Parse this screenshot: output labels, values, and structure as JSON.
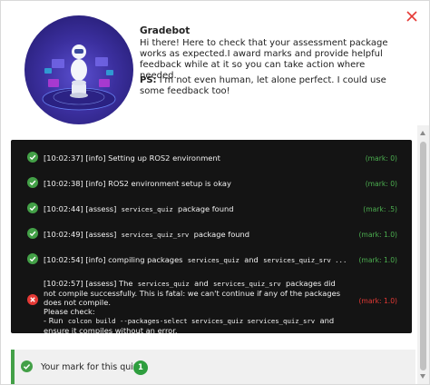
{
  "dialog": {
    "close_icon": "close-x-icon",
    "close_color": "#e53935"
  },
  "bot": {
    "name": "Gradebot",
    "intro": "Hi there! Here to check that your assessment package works as expected.I award marks and provide helpful feedback while at it so you can take action where needed.",
    "ps_label": "PS:",
    "ps_text": " I'm not even human, let alone perfect. I could use some feedback too!"
  },
  "log": {
    "entries": [
      {
        "status": "success",
        "icon": "check-circle-icon",
        "time": "[10:02:37]",
        "tag": "[info]",
        "text": "Setting up ROS2 environment",
        "mark": "(mark: 0)"
      },
      {
        "status": "success",
        "icon": "check-circle-icon",
        "time": "[10:02:38]",
        "tag": "[info]",
        "text": "ROS2 environment setup is okay",
        "mark": "(mark: 0)"
      },
      {
        "status": "success",
        "icon": "check-circle-icon",
        "time": "[10:02:44]",
        "tag": "[assess]",
        "code": "services_quiz",
        "text": "package found",
        "mark": "(mark: .5)"
      },
      {
        "status": "success",
        "icon": "check-circle-icon",
        "time": "[10:02:49]",
        "tag": "[assess]",
        "code": "services_quiz_srv",
        "text": "package found",
        "mark": "(mark: 1.0)"
      },
      {
        "status": "success",
        "icon": "check-circle-icon",
        "time": "[10:02:54]",
        "tag": "[info]",
        "text_pre": "compiling packages",
        "code1": "services_quiz",
        "text_mid": "and",
        "code2": "services_quiz_srv ...",
        "mark": "(mark: 1.0)"
      },
      {
        "status": "failure",
        "icon": "error-circle-icon",
        "time": "[10:02:57]",
        "tag": "[assess]",
        "text_pre": "The",
        "code1": "services_quiz",
        "text_mid": "and",
        "code2": "services_quiz_srv",
        "text_post": "packages did not compile successfully. This is fatal: we can't continue if any of the packages does not compile.",
        "line2": "Please check:",
        "line3_pre": "- Run",
        "line3_code": "colcon build --packages-select services_quiz services_quiz_srv",
        "line3_post": "and ensure it compiles without an error.",
        "mark": "(mark: 1.0)"
      }
    ],
    "success_color": "#4caf50",
    "failure_color": "#e53935",
    "background": "#141414"
  },
  "result": {
    "label": "Your mark for this quiz",
    "score": "1",
    "icon": "check-circle-icon",
    "accent": "#43a047"
  }
}
